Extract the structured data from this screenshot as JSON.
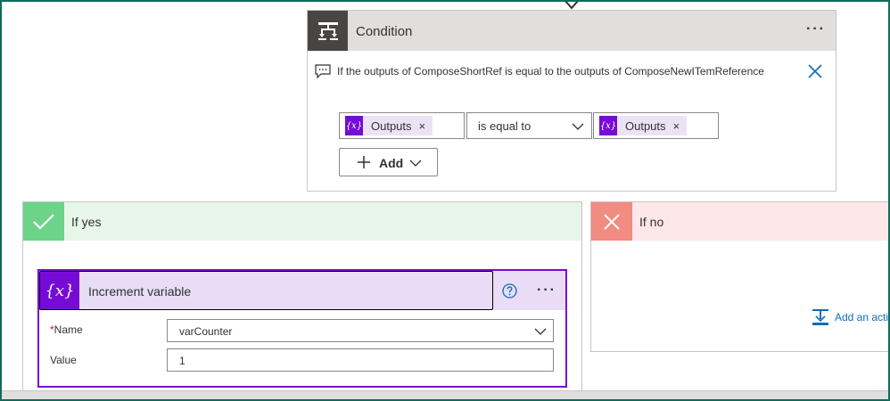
{
  "condition": {
    "title": "Condition",
    "note": "If the outputs of ComposeShortRef is equal to the outputs of ComposeNewITemReference",
    "left_operand": {
      "token_icon": "{x}",
      "label": "Outputs"
    },
    "operator": "is equal to",
    "right_operand": {
      "token_icon": "{x}",
      "label": "Outputs"
    },
    "add_label": "Add",
    "more_label": "···"
  },
  "branch_yes": {
    "title": "If yes",
    "action": {
      "title": "Increment variable",
      "icon_text": "{x}",
      "more_label": "···",
      "fields": {
        "name_required_mark": "*",
        "name_label": "Name",
        "name_value": "varCounter",
        "value_label": "Value",
        "value_value": "1"
      }
    }
  },
  "branch_no": {
    "title": "If no",
    "add_action_label": "Add an action"
  },
  "colors": {
    "accent_purple": "#770bd6",
    "yes_green": "#6cd388",
    "no_red": "#f28b82",
    "link_blue": "#0f6cbd"
  }
}
